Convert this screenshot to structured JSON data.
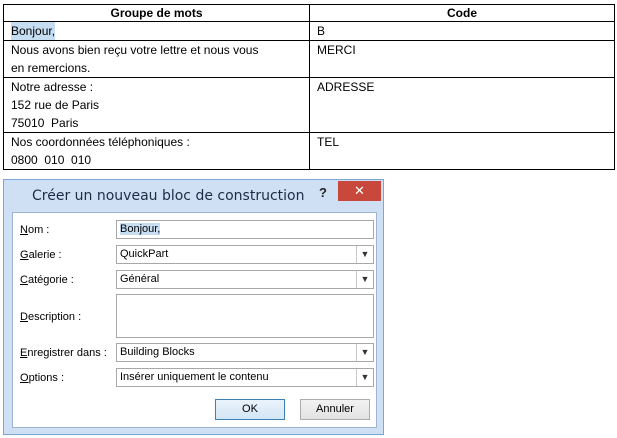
{
  "table": {
    "headers": [
      "Groupe de mots",
      "Code"
    ],
    "rows": [
      {
        "group": [
          "Bonjour,"
        ],
        "code": "B"
      },
      {
        "group": [
          "Nous avons bien reçu votre lettre et nous vous",
          "en remercions."
        ],
        "code": "MERCI"
      },
      {
        "group": [
          "Notre adresse :",
          "152 rue de Paris",
          "75010  Paris"
        ],
        "code": "ADRESSE"
      },
      {
        "group": [
          "Nos coordonnées téléphoniques :",
          "0800  010  010"
        ],
        "code": "TEL"
      }
    ]
  },
  "dialog": {
    "title": "Créer un nouveau bloc de construction",
    "help": "?",
    "close": "✕",
    "fields": {
      "name": {
        "label_u": "N",
        "label_rest": "om :",
        "value": "Bonjour,"
      },
      "gallery": {
        "label_u": "G",
        "label_rest": "alerie :",
        "value": "QuickPart"
      },
      "category": {
        "label_u": "C",
        "label_rest": "atégorie :",
        "value": "Général"
      },
      "description": {
        "label_u": "D",
        "label_rest": "escription :",
        "value": ""
      },
      "save_in": {
        "label_u": "E",
        "label_rest": "nregistrer dans :",
        "value": "Building Blocks"
      },
      "options": {
        "label_u": "O",
        "label_rest": "ptions :",
        "value": "Insérer uniquement le contenu"
      }
    },
    "ok_label": "OK",
    "cancel_label": "Annuler",
    "icons": {
      "dropdown": "chevron-down-icon"
    }
  }
}
